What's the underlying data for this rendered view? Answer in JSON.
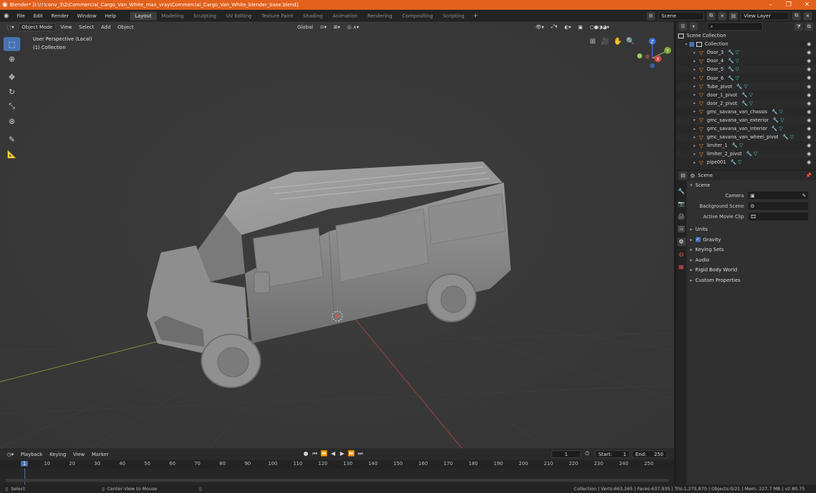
{
  "window": {
    "title": "Blender* [I:\\!!!conv_3\\2\\Commercial_Cargo_Van_White_max_vray\\Commercial_Cargo_Van_White_blender_base.blend]"
  },
  "menu": [
    "File",
    "Edit",
    "Render",
    "Window",
    "Help"
  ],
  "workspaces": [
    "Layout",
    "Modeling",
    "Sculpting",
    "UV Editing",
    "Texture Paint",
    "Shading",
    "Animation",
    "Rendering",
    "Compositing",
    "Scripting"
  ],
  "active_workspace": "Layout",
  "scene_name": "Scene",
  "view_layer": "View Layer",
  "viewport": {
    "mode": "Object Mode",
    "menus": [
      "View",
      "Select",
      "Add",
      "Object"
    ],
    "orientation": "Global",
    "perspective_label": "User Perspective (Local)",
    "collection_label": "(1) Collection",
    "gizmo": {
      "x": "X",
      "y": "Y",
      "z": "Z"
    }
  },
  "outliner": {
    "root": "Scene Collection",
    "collection": "Collection",
    "items": [
      "Door_3",
      "Door_4",
      "Door_5",
      "Door_6",
      "Tube_pivot",
      "door_1_pivot",
      "door_2_pivot",
      "gmc_savana_van_chassis",
      "gmc_savana_van_exterior",
      "gmc_savana_van_interior",
      "gmc_savana_van_wheel_pivot",
      "limiter_1",
      "limiter_2_pivot",
      "pipe001"
    ]
  },
  "properties": {
    "header": "Scene",
    "panel": "Scene",
    "camera_label": "Camera",
    "background_scene_label": "Background Scene",
    "active_movie_clip_label": "Active Movie Clip",
    "sections": [
      "Units",
      "Gravity",
      "Keying Sets",
      "Audio",
      "Rigid Body World",
      "Custom Properties"
    ]
  },
  "timeline": {
    "menus": [
      "Playback",
      "Keying",
      "View",
      "Marker"
    ],
    "current_frame": "1",
    "start_label": "Start:",
    "start": "1",
    "end_label": "End:",
    "end": "250",
    "ruler": [
      "1",
      "10",
      "20",
      "30",
      "40",
      "50",
      "60",
      "70",
      "80",
      "90",
      "100",
      "110",
      "120",
      "130",
      "140",
      "150",
      "160",
      "170",
      "180",
      "190",
      "200",
      "210",
      "220",
      "230",
      "240",
      "250"
    ]
  },
  "status": {
    "select": "Select",
    "center_view": "Center View to Mouse",
    "stats": "Collection | Verts:663,265 | Faces:637,935 | Tris:1,275,870 | Objects:0/21 | Mem: 227.7 MB | v2.80.75"
  },
  "colors": {
    "title_bar": "#e4611d",
    "accent": "#4772b3",
    "viewport_bg": "#393939",
    "mesh_icon": "#e88e3c"
  }
}
